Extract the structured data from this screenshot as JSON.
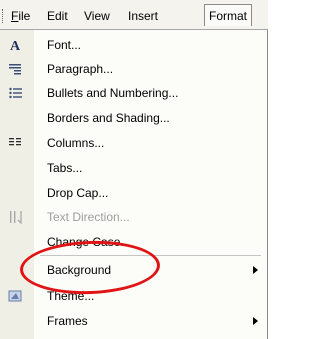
{
  "menubar": {
    "items": [
      {
        "label": "File"
      },
      {
        "label": "Edit"
      },
      {
        "label": "View"
      },
      {
        "label": "Insert"
      },
      {
        "label": "Format"
      }
    ]
  },
  "menu": {
    "items": [
      {
        "label": "Font...",
        "icon": "font-a-icon",
        "disabled": false,
        "submenu": false
      },
      {
        "label": "Paragraph...",
        "icon": "paragraph-icon",
        "disabled": false,
        "submenu": false
      },
      {
        "label": "Bullets and Numbering...",
        "icon": "bullets-icon",
        "disabled": false,
        "submenu": false
      },
      {
        "label": "Borders and Shading...",
        "icon": "",
        "disabled": false,
        "submenu": false
      },
      {
        "label": "Columns...",
        "icon": "columns-icon",
        "disabled": false,
        "submenu": false
      },
      {
        "label": "Tabs...",
        "icon": "",
        "disabled": false,
        "submenu": false
      },
      {
        "label": "Drop Cap...",
        "icon": "",
        "disabled": false,
        "submenu": false
      },
      {
        "label": "Text Direction...",
        "icon": "text-direction-icon",
        "disabled": true,
        "submenu": false
      },
      {
        "label": "Change Case...",
        "icon": "",
        "disabled": false,
        "submenu": false
      },
      {
        "label": "Background",
        "icon": "",
        "disabled": false,
        "submenu": true
      },
      {
        "label": "Theme...",
        "icon": "theme-icon",
        "disabled": false,
        "submenu": false
      },
      {
        "label": "Frames",
        "icon": "",
        "disabled": false,
        "submenu": true
      }
    ]
  },
  "annotation": {
    "color": "#e01414"
  }
}
